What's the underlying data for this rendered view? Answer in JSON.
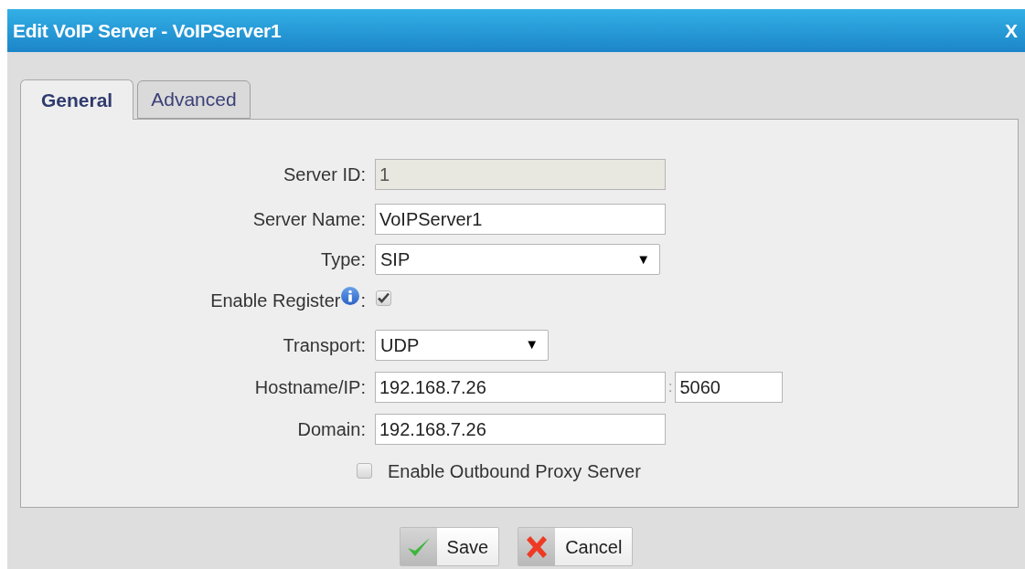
{
  "window": {
    "title": "Edit VoIP Server - VoIPServer1",
    "close": "X"
  },
  "tabs": [
    {
      "label": "General",
      "selected": true
    },
    {
      "label": "Advanced",
      "selected": false
    }
  ],
  "fields": [
    {
      "kind": "text",
      "label": "Server ID:",
      "value": "1",
      "disabled": true
    },
    {
      "kind": "text",
      "label": "Server Name:",
      "value": "VoIPServer1",
      "disabled": false
    },
    {
      "kind": "select",
      "label": "Type:",
      "value": "SIP",
      "arrow": "▼"
    },
    {
      "kind": "checkbox",
      "label": "Enable Register",
      "suffix": ":",
      "checked": true,
      "info": true
    },
    {
      "kind": "select-narrow",
      "label": "Transport:",
      "value": "UDP",
      "arrow": "▼"
    },
    {
      "kind": "host",
      "label": "Hostname/IP:",
      "value": "192.168.7.26",
      "separator": ":",
      "port": "5060"
    },
    {
      "kind": "text",
      "label": "Domain:",
      "value": "192.168.7.26",
      "disabled": false
    },
    {
      "kind": "option",
      "label": "Enable Outbound Proxy Server",
      "checked": false
    }
  ],
  "buttons": [
    {
      "kind": "save",
      "label": "Save"
    },
    {
      "kind": "cancel",
      "label": "Cancel"
    }
  ]
}
